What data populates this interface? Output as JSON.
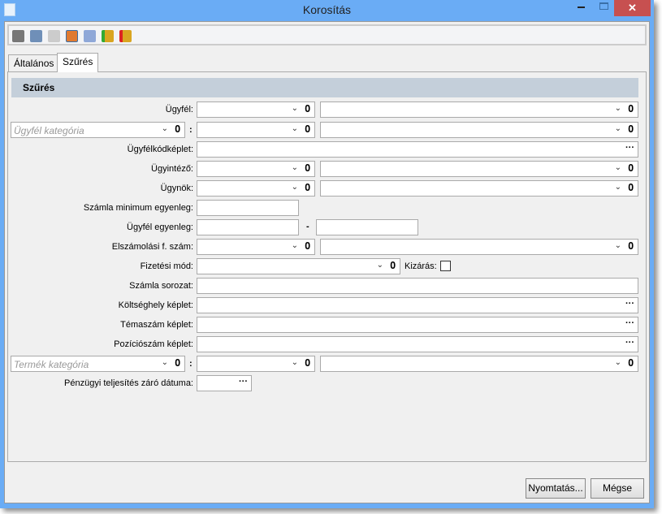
{
  "window": {
    "title": "Korosítás",
    "close": "✕"
  },
  "toolbar": {
    "icons": [
      "print-icon",
      "preview-icon",
      "export-icon",
      "edit-icon",
      "calculator-icon",
      "db-import-icon",
      "db-export-icon"
    ]
  },
  "tabs": [
    {
      "label": "Általános"
    },
    {
      "label": "Szűrés"
    }
  ],
  "section": {
    "title": "Szűrés"
  },
  "form": {
    "ugyfel": "Ügyfél:",
    "ugyfel_kategoria": "Ügyfél kategória",
    "colon": ":",
    "ugyfelkodkeplet": "Ügyfélkódképlet:",
    "ugyintezo": "Ügyintéző:",
    "ugynok": "Ügynök:",
    "szamla_min": "Számla minimum egyenleg:",
    "ugyfel_egyenleg": "Ügyfél egyenleg:",
    "dash": "-",
    "elszamolasi": "Elszámolási f. szám:",
    "fizetesi_mod": "Fizetési mód:",
    "kizaras": "Kizárás:",
    "szamla_sorozat": "Számla sorozat:",
    "koltseghely": "Költséghely képlet:",
    "temaszam": "Témaszám képlet:",
    "pozicioszam": "Pozíciószám képlet:",
    "termek_kategoria": "Termék kategória",
    "penzugyi": "Pénzügyi teljesítés záró dátuma:"
  },
  "buttons": {
    "print": "Nyomtatás...",
    "cancel": "Mégse"
  },
  "glyphs": {
    "dropdown": "⌄",
    "clip": "𝟎",
    "dots": "···"
  }
}
